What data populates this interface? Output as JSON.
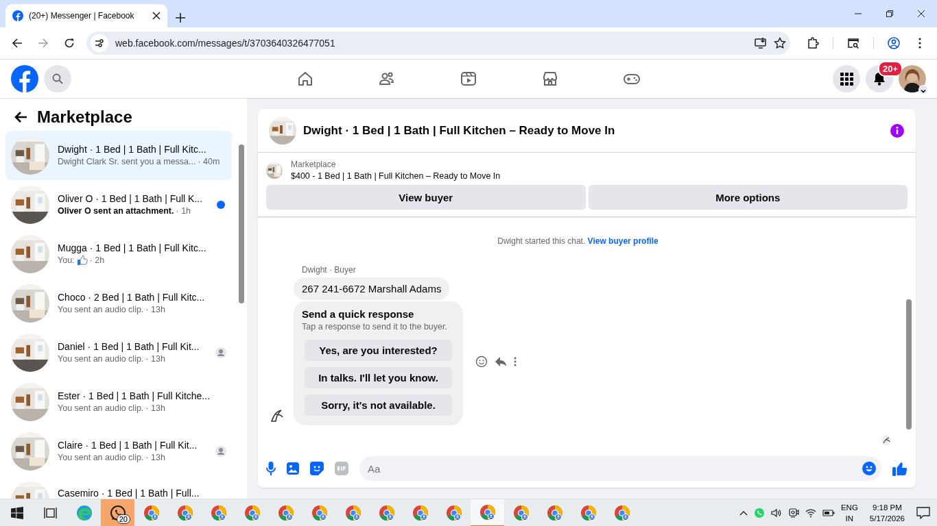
{
  "browser": {
    "tab_title": "(20+) Messenger | Facebook",
    "url": "web.facebook.com/messages/t/3703640326477051"
  },
  "header": {
    "notification_badge": "20+",
    "nav": [
      {
        "kind": "home",
        "selected": false
      },
      {
        "kind": "friends",
        "selected": false
      },
      {
        "kind": "video",
        "selected": false
      },
      {
        "kind": "marketplace",
        "selected": false
      },
      {
        "kind": "gaming",
        "selected": false
      }
    ]
  },
  "sidebar": {
    "title": "Marketplace",
    "conversations": [
      {
        "kind": "text",
        "title": "Dwight · 1 Bed | 1 Bath | Full Kitc...",
        "preview": "Dwight Clark Sr. sent you a messa...",
        "time": "· 40m",
        "selected": true,
        "unread": false,
        "seen": false
      },
      {
        "kind": "text",
        "title": "Oliver O · 1 Bed | 1 Bath | Full K...",
        "preview": "Oliver O sent an attachment.",
        "time": "· 1h",
        "selected": false,
        "unread": true,
        "seen": false
      },
      {
        "kind": "like",
        "title": "Mugga · 1 Bed | 1 Bath | Full Kitc...",
        "preview": "You:",
        "time": "· 2h",
        "selected": false,
        "unread": false,
        "seen": false
      },
      {
        "kind": "text",
        "title": "Choco · 2 Bed | 1 Bath | Full Kitc...",
        "preview": "You sent an audio clip.",
        "time": "· 13h",
        "selected": false,
        "unread": false,
        "seen": false
      },
      {
        "kind": "text",
        "title": "Daniel · 1 Bed | 1 Bath | Full Kit...",
        "preview": "You sent an audio clip.",
        "time": "· 13h",
        "selected": false,
        "unread": false,
        "seen": true
      },
      {
        "kind": "text",
        "title": "Ester · 1 Bed | 1 Bath | Full Kitche...",
        "preview": "You sent an audio clip.",
        "time": "· 13h",
        "selected": false,
        "unread": false,
        "seen": false
      },
      {
        "kind": "text",
        "title": "Claire · 1 Bed | 1 Bath | Full Kit...",
        "preview": "You sent an audio clip.",
        "time": "· 13h",
        "selected": false,
        "unread": false,
        "seen": true
      },
      {
        "kind": "text",
        "title": "Casemiro · 1 Bed | 1 Bath | Full...",
        "selected": false,
        "unread": false,
        "seen": false
      }
    ]
  },
  "chat": {
    "title": "Dwight · 1 Bed | 1 Bath | Full Kitchen – Ready to Move In",
    "listing": {
      "label": "Marketplace",
      "text": "$400 - 1 Bed | 1 Bath | Full Kitchen – Ready to Move In"
    },
    "buttons": [
      "View buyer",
      "More options"
    ],
    "notice": "Dwight started this chat.",
    "notice_link": "View buyer profile",
    "sender": "Dwight · Buyer",
    "message": "267 241-6672 Marshall Adams",
    "quick_response": {
      "title": "Send a quick response",
      "subtitle": "Tap a response to send it to the buyer.",
      "options": [
        "Yes, are you interested?",
        "In talks. I'll let you know.",
        "Sorry, it's not available."
      ]
    },
    "composer": {
      "placeholder": "Aa"
    }
  },
  "taskbar": {
    "apps": [
      {
        "kind": "edge",
        "selected": false,
        "highlighted": false
      },
      {
        "kind": "whatsapp",
        "badge": "20",
        "selected": false,
        "highlighted": true
      },
      {
        "kind": "chrome",
        "selected": false,
        "highlighted": false
      },
      {
        "kind": "chrome",
        "selected": false,
        "highlighted": false
      },
      {
        "kind": "chrome",
        "selected": false,
        "highlighted": false
      },
      {
        "kind": "chrome",
        "selected": false,
        "highlighted": false
      },
      {
        "kind": "chrome",
        "selected": false,
        "highlighted": false
      },
      {
        "kind": "chrome",
        "selected": false,
        "highlighted": false
      },
      {
        "kind": "chrome",
        "selected": false,
        "highlighted": false
      },
      {
        "kind": "chrome",
        "selected": false,
        "highlighted": false
      },
      {
        "kind": "chrome",
        "selected": false,
        "highlighted": false
      },
      {
        "kind": "chrome",
        "selected": false,
        "highlighted": false
      },
      {
        "kind": "chrome",
        "selected": true,
        "highlighted": false
      },
      {
        "kind": "chrome",
        "selected": false,
        "highlighted": false
      },
      {
        "kind": "chrome",
        "selected": false,
        "highlighted": false
      },
      {
        "kind": "chrome",
        "selected": false,
        "highlighted": false
      },
      {
        "kind": "chrome",
        "selected": false,
        "highlighted": false
      }
    ],
    "language": "ENG",
    "region": "IN",
    "time": "9:18 PM",
    "date": "5/17/2026"
  }
}
